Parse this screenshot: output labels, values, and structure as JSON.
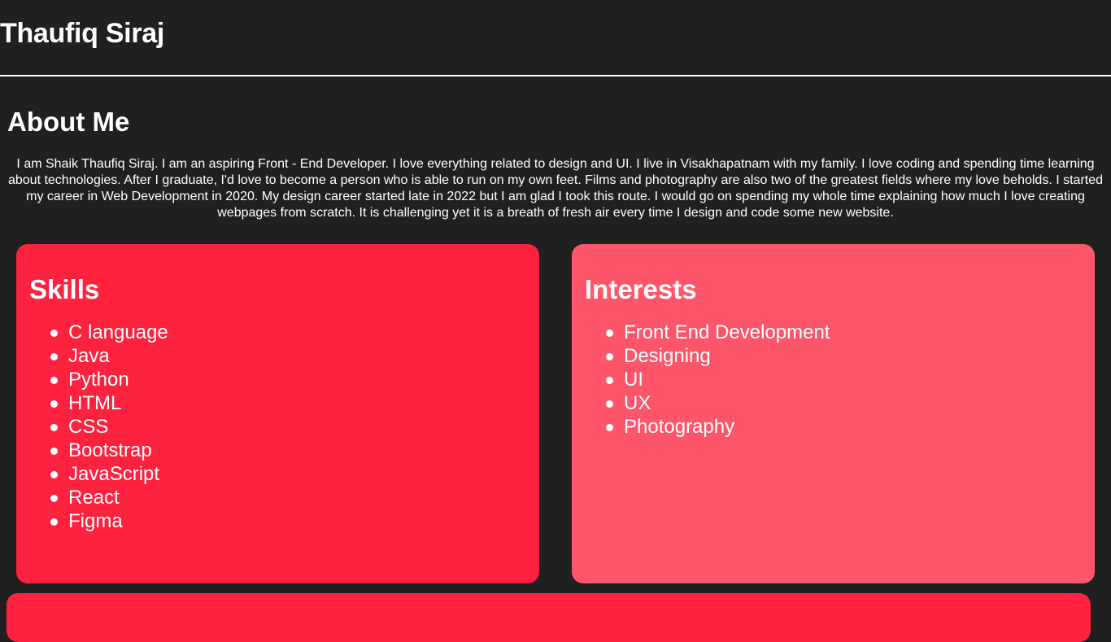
{
  "header": {
    "title": "Thaufiq Siraj"
  },
  "about": {
    "heading": "About Me",
    "text": "I am Shaik Thaufiq Siraj. I am an aspiring Front - End Developer. I love everything related to design and UI. I live in Visakhapatnam with my family. I love coding and spending time learning about technologies. After I graduate, I'd love to become a person who is able to run on my own feet. Films and photography are also two of the greatest fields where my love beholds. I started my career in Web Development in 2020. My design career started late in 2022 but I am glad I took this route. I would go on spending my whole time explaining how much I love creating webpages from scratch. It is challenging yet it is a breath of fresh air every time I design and code some new website."
  },
  "skills": {
    "heading": "Skills",
    "items": [
      "C language",
      "Java",
      "Python",
      "HTML",
      "CSS",
      "Bootstrap",
      "JavaScript",
      "React",
      "Figma"
    ]
  },
  "interests": {
    "heading": "Interests",
    "items": [
      "Front End Development",
      "Designing",
      "UI",
      "UX",
      "Photography"
    ]
  },
  "colors": {
    "background": "#202020",
    "skills_card": "#fe223f",
    "interests_card": "#fd566a",
    "text": "#ffffff"
  }
}
